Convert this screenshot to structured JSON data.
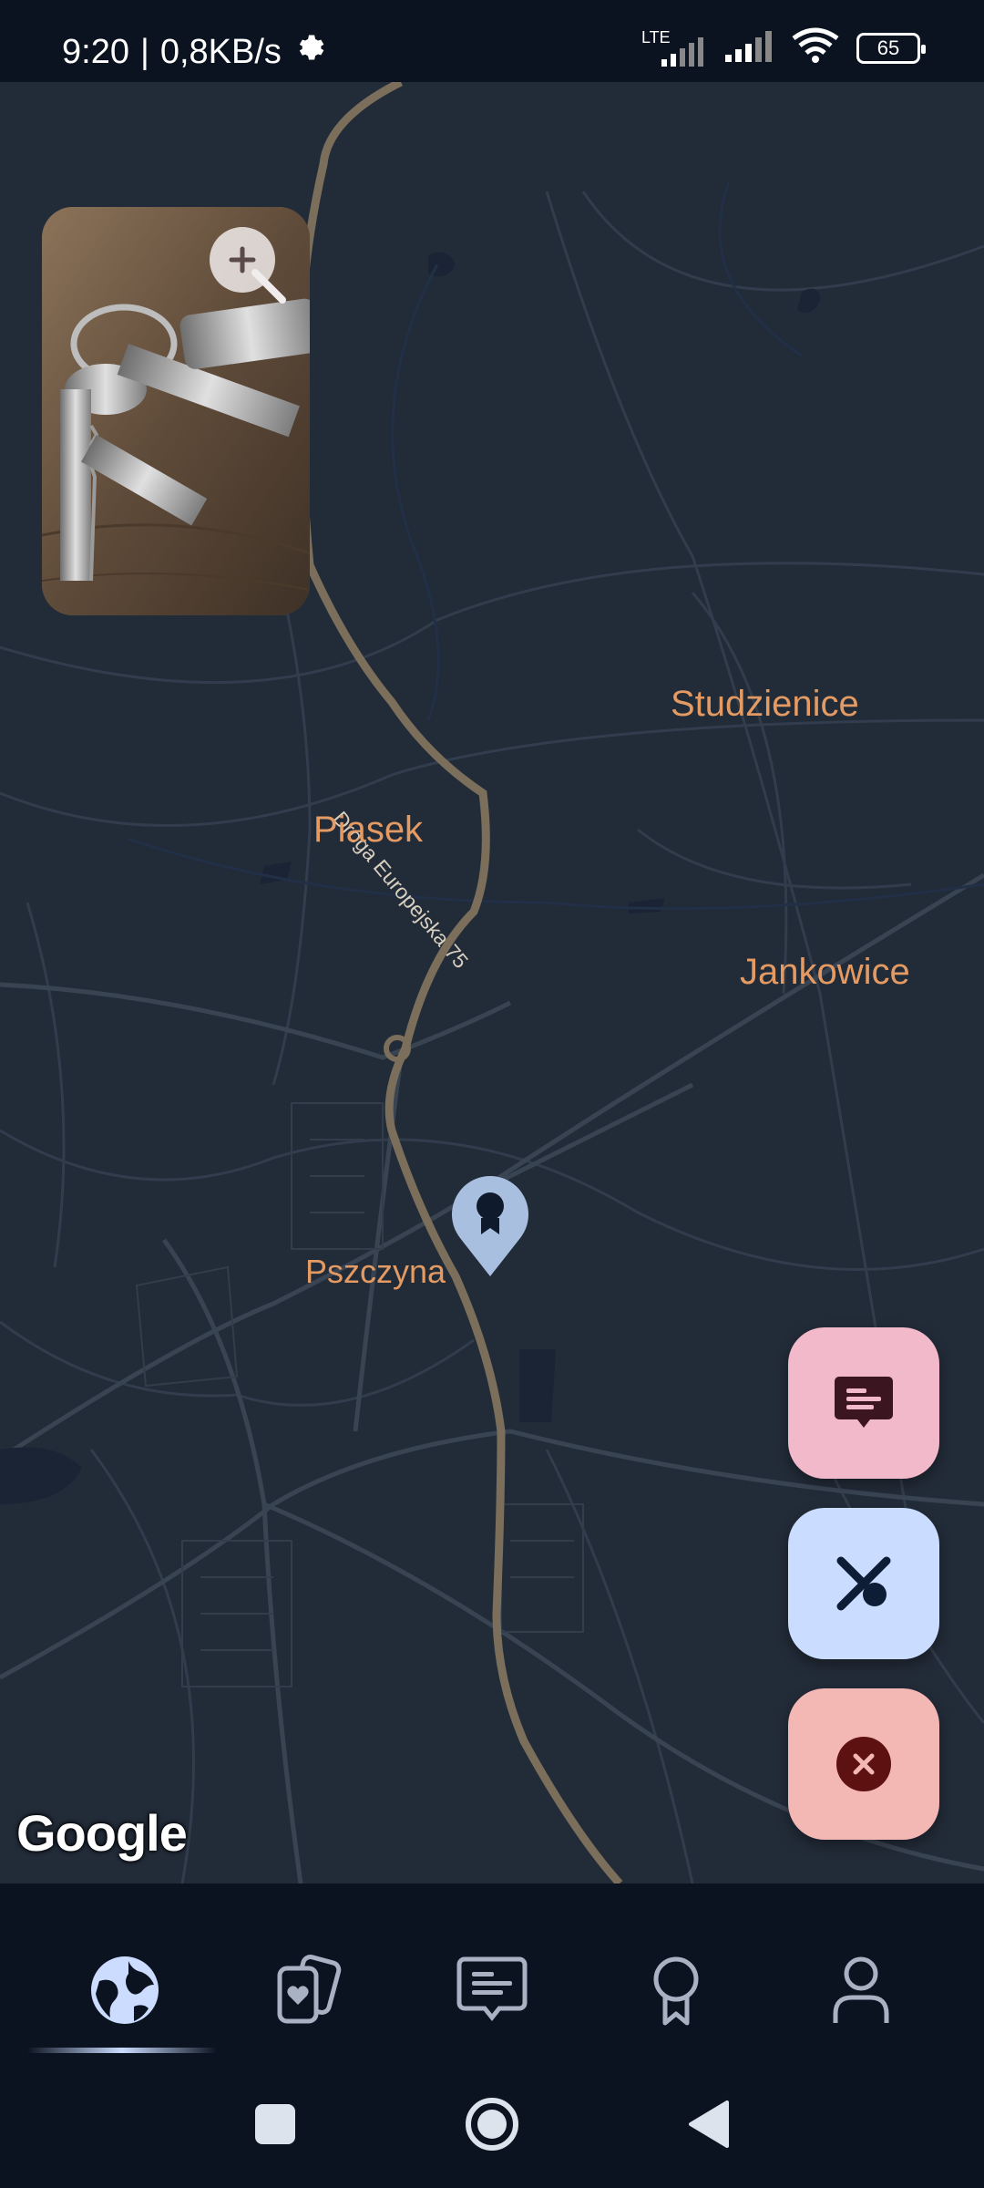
{
  "status_bar": {
    "time": "9:20",
    "separator": "|",
    "speed": "0,8KB/s",
    "network": "LTE",
    "battery": "65"
  },
  "map": {
    "road_label": "Droga Europejska 75",
    "places": {
      "studzienice": "Studzienice",
      "piasek": "Piasek",
      "jankowice": "Jankowice",
      "pszczyna": "Pszczyna"
    },
    "attribution": "Google"
  },
  "colors": {
    "map_bg": "#222b38",
    "road": "#7b6e5a",
    "place_label": "#e39a63",
    "fab_chat": "#f1b9ca",
    "fab_tools": "#cadcff",
    "fab_close": "#f3b7b4",
    "nav_bg": "#0b1320",
    "active_nav": "#cbdcff"
  },
  "icons": {
    "zoom": "zoom-in-icon",
    "marker": "award-marker-icon",
    "fab_chat": "chat-icon",
    "fab_tools": "tools-icon",
    "fab_close": "close-icon",
    "nav": [
      "globe-icon",
      "cards-icon",
      "chat-icon",
      "award-icon",
      "person-icon"
    ]
  },
  "bottom_nav": {
    "active_index": 0
  }
}
